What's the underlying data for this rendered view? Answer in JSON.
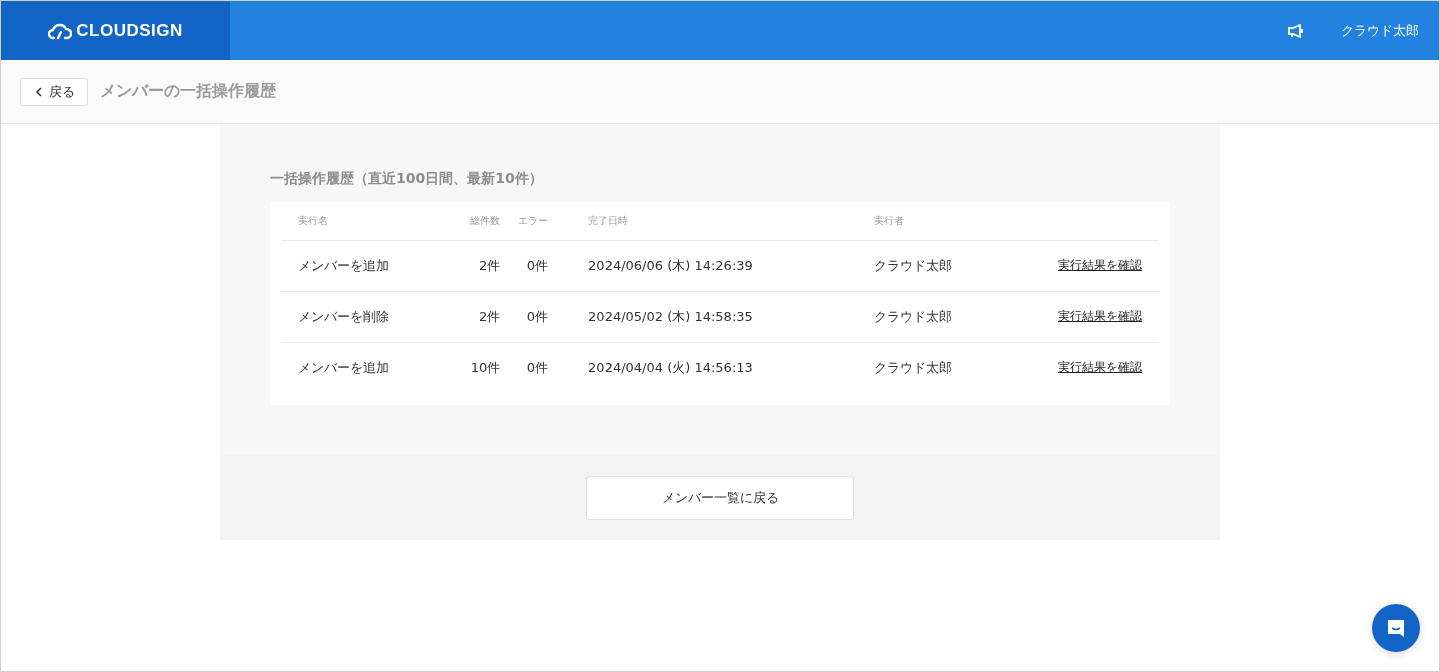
{
  "header": {
    "logo": "CLOUDSIGN",
    "user": "クラウド太郎"
  },
  "subheader": {
    "back": "戻る",
    "title": "メンバーの一括操作履歴"
  },
  "section_title": "一括操作履歴（直近100日間、最新10件）",
  "table": {
    "columns": [
      "実行名",
      "総件数",
      "エラー",
      "完了日時",
      "実行者"
    ],
    "rows": [
      {
        "name": "メンバーを追加",
        "total": "2件",
        "errors": "0件",
        "completed": "2024/06/06 (木) 14:26:39",
        "executor": "クラウド太郎",
        "link": "実行結果を確認"
      },
      {
        "name": "メンバーを削除",
        "total": "2件",
        "errors": "0件",
        "completed": "2024/05/02 (木) 14:58:35",
        "executor": "クラウド太郎",
        "link": "実行結果を確認"
      },
      {
        "name": "メンバーを追加",
        "total": "10件",
        "errors": "0件",
        "completed": "2024/04/04 (火) 14:56:13",
        "executor": "クラウド太郎",
        "link": "実行結果を確認"
      }
    ]
  },
  "footer_button": "メンバー一覧に戻る"
}
